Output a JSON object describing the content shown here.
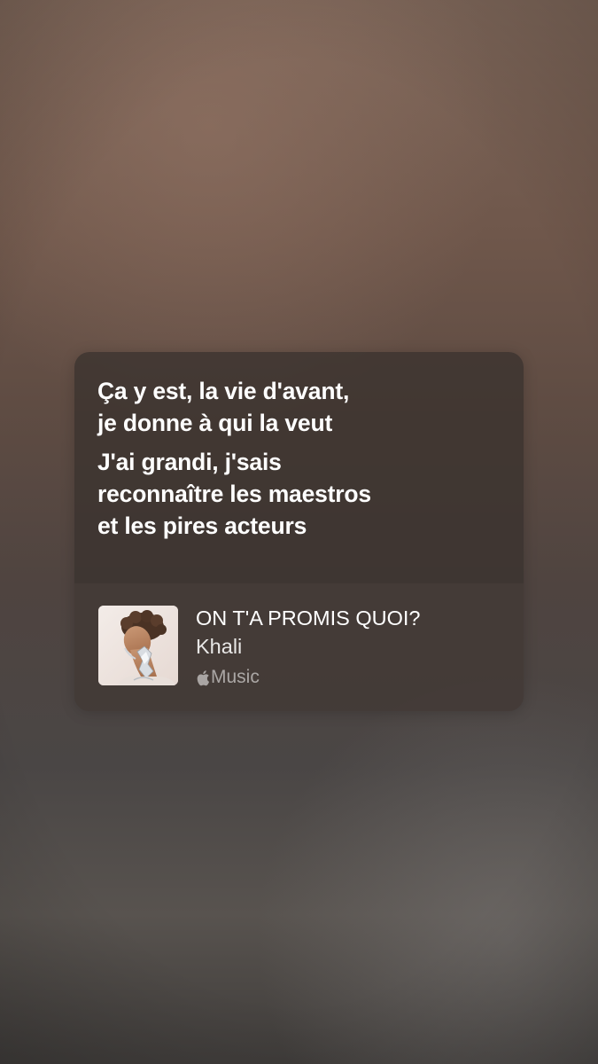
{
  "lyrics_card": {
    "lines": [
      "Ça y est, la vie d'avant,\nje donne à qui la veut",
      "J'ai grandi, j'sais\nreconnaître les maestros\net les pires acteurs"
    ]
  },
  "track": {
    "title": "ON T'A PROMIS QUOI?",
    "artist": "Khali",
    "service_label": "Music",
    "service_icon": "apple-logo-icon",
    "album_art": "album-cover-image"
  },
  "colors": {
    "card_background": "#3a322e",
    "lyric_text": "#ffffff",
    "service_text": "#a8a4a2"
  }
}
